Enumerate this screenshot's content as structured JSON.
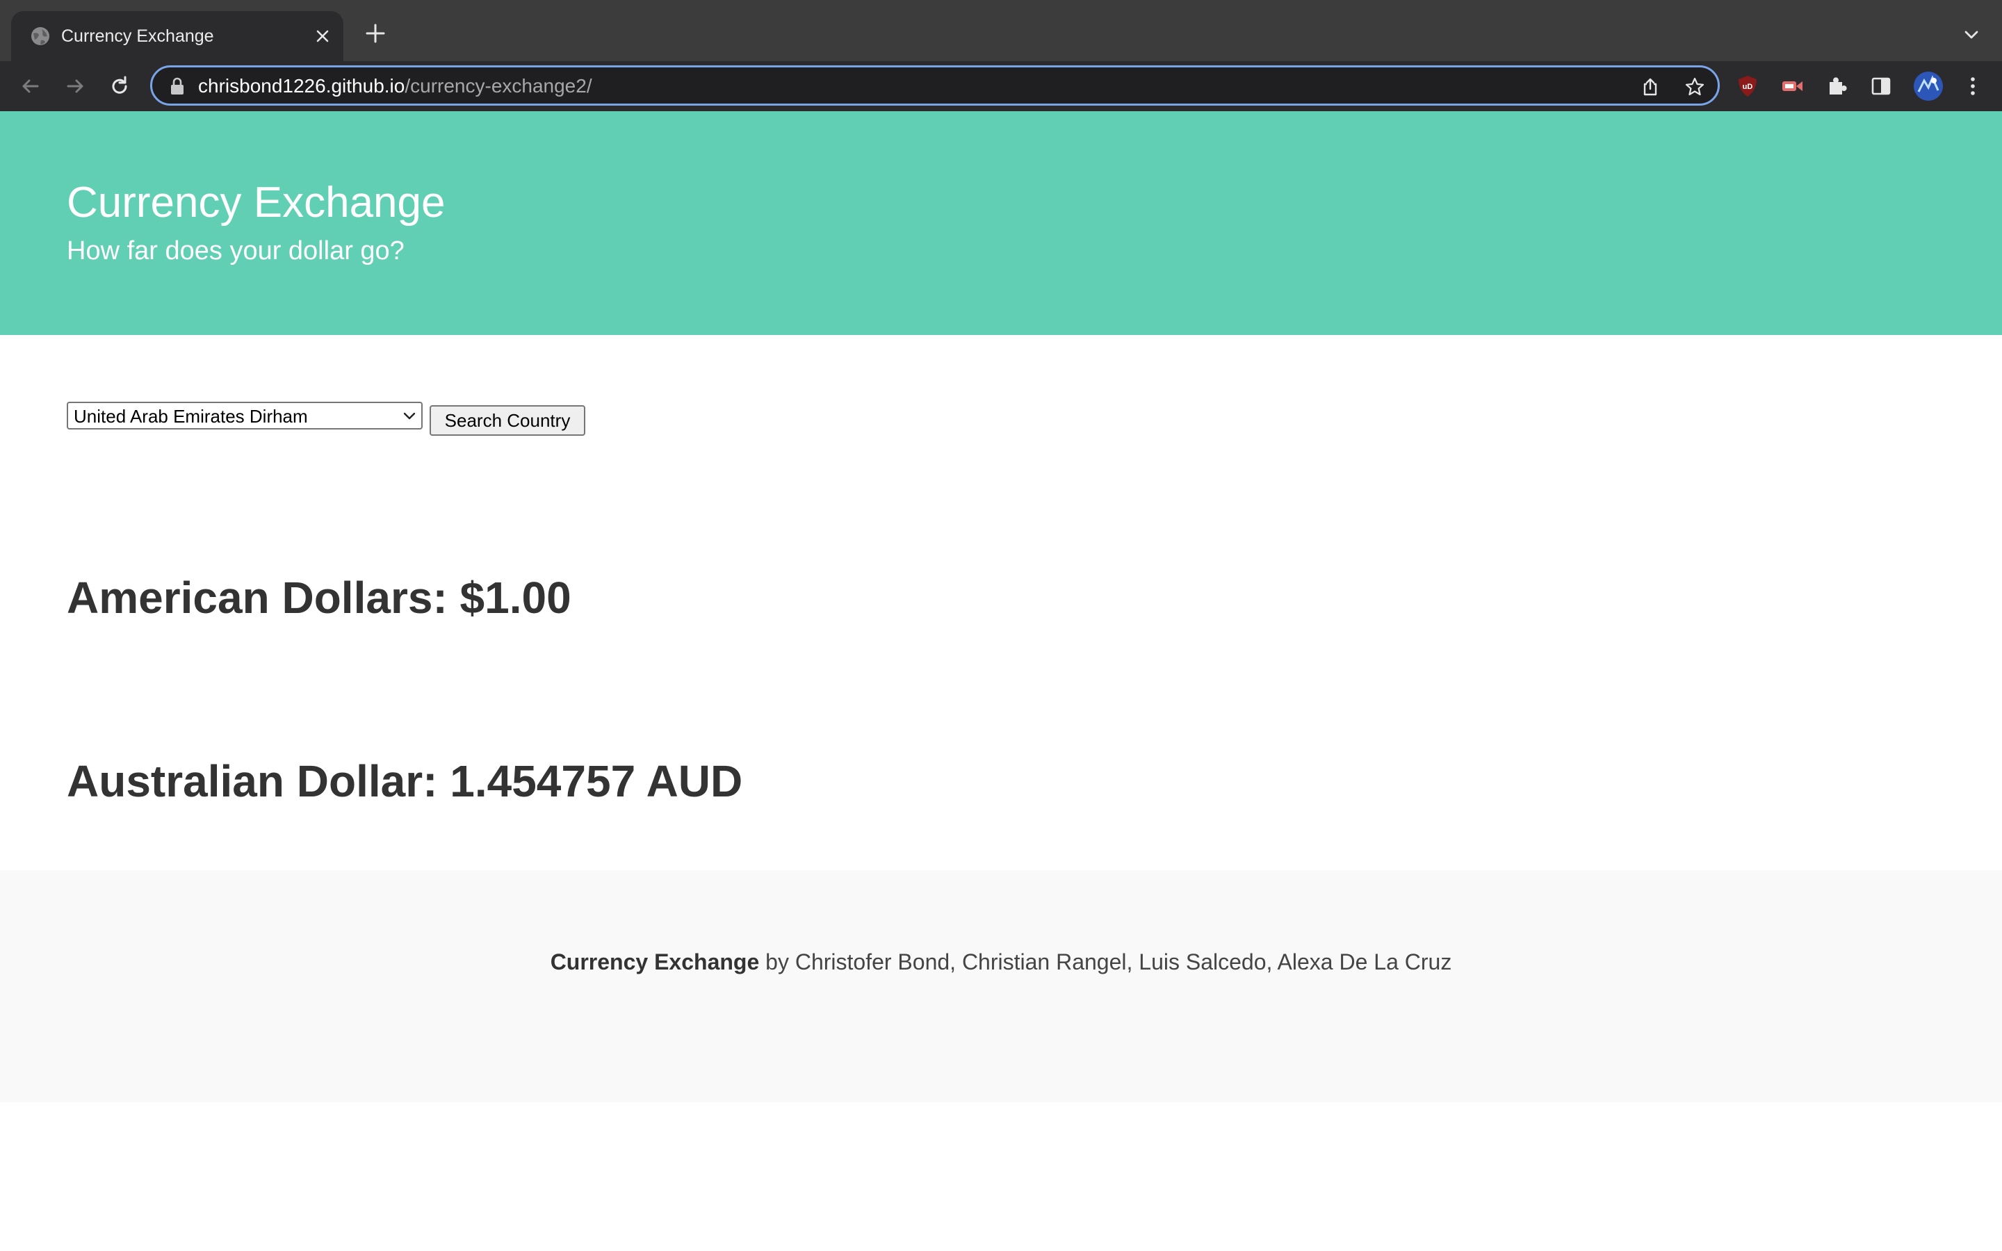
{
  "browser": {
    "tab": {
      "title": "Currency Exchange"
    },
    "address_bar": {
      "host": "chrisbond1226.github.io",
      "path": "/currency-exchange2/"
    },
    "icons": {
      "tab_favicon": "globe-icon",
      "tab_close": "close-icon",
      "new_tab": "plus-icon",
      "tab_search": "chevron-down-icon",
      "back": "arrow-left-icon",
      "forward": "arrow-right-icon",
      "reload": "reload-icon",
      "lock": "lock-icon",
      "share": "share-icon",
      "bookmark": "star-icon",
      "extensions": [
        "ublock-icon",
        "video-extension-icon",
        "puzzle-icon",
        "side-panel-icon",
        "profile-avatar"
      ],
      "menu": "kebab-menu-icon"
    },
    "colors": {
      "tabstrip": "#3c3c3d",
      "toolbar": "#2b2b2d",
      "omnibox_border": "#7aa4e8"
    }
  },
  "hero": {
    "title": "Currency Exchange",
    "subtitle": "How far does your dollar go?",
    "background_color": "#61cfb3"
  },
  "controls": {
    "currency_select": {
      "selected": "United Arab Emirates Dirham"
    },
    "search_button_label": "Search Country"
  },
  "results": {
    "usd_line": "American Dollars: $1.00",
    "rate_line": "Australian Dollar: 1.454757 AUD"
  },
  "footer": {
    "brand": "Currency Exchange",
    "credits": " by Christofer Bond, Christian Rangel, Luis Salcedo, Alexa De La Cruz"
  }
}
